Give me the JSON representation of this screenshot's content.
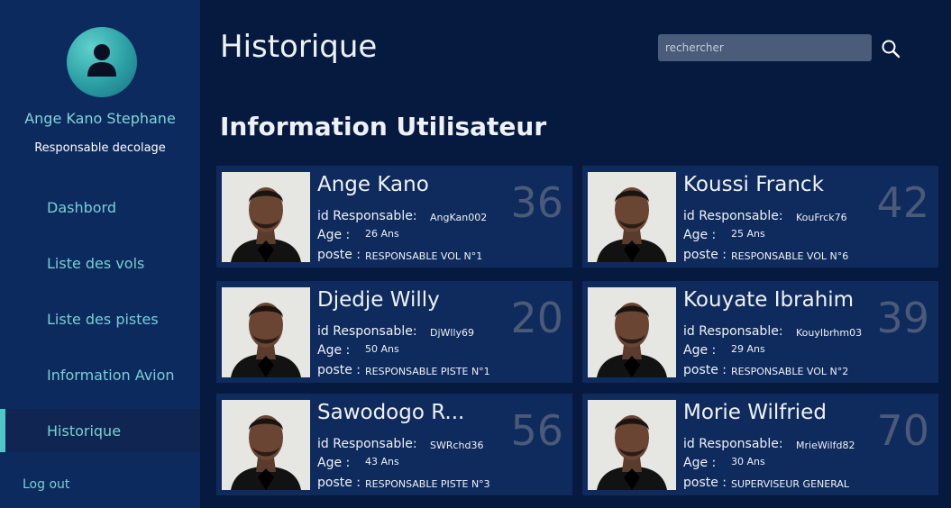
{
  "sidebar": {
    "user_name": "Ange Kano Stephane",
    "user_role": "Responsable decolage",
    "items": [
      {
        "label": "Dashbord"
      },
      {
        "label": "Liste des vols"
      },
      {
        "label": "Liste des pistes"
      },
      {
        "label": "Information Avion"
      },
      {
        "label": "Historique"
      }
    ],
    "logout": "Log out"
  },
  "header": {
    "title": "Historique",
    "search_placeholder": "rechercher"
  },
  "section": {
    "title": "Information Utilisateur"
  },
  "labels": {
    "id": "id Responsable:",
    "age": "Age :",
    "poste": "poste :"
  },
  "cards": [
    {
      "name": "Ange Kano",
      "id": "AngKan002",
      "age": "26 Ans",
      "poste": "RESPONSABLE VOL N°1",
      "big_number": "36"
    },
    {
      "name": "Koussi Franck",
      "id": "KouFrck76",
      "age": "25 Ans",
      "poste": "RESPONSABLE VOL N°6",
      "big_number": "42"
    },
    {
      "name": "Djedje Willy",
      "id": "DjWlly69",
      "age": "50 Ans",
      "poste": "RESPONSABLE PISTE N°1",
      "big_number": "20"
    },
    {
      "name": "Kouyate Ibrahim",
      "id": "KouyIbrhm03",
      "age": "29 Ans",
      "poste": "RESPONSABLE VOL N°2",
      "big_number": "39"
    },
    {
      "name": "Sawodogo R...",
      "id": "SWRchd36",
      "age": "43 Ans",
      "poste": "RESPONSABLE PISTE N°3",
      "big_number": "56"
    },
    {
      "name": "Morie Wilfried",
      "id": "MrieWilfd82",
      "age": "30 Ans",
      "poste": "SUPERVISEUR GENERAL",
      "big_number": "70"
    }
  ],
  "colors": {
    "background": "#061a40",
    "sidebar": "#0d2a5e",
    "card": "#0f2a5c",
    "accent": "#76d0d3"
  }
}
